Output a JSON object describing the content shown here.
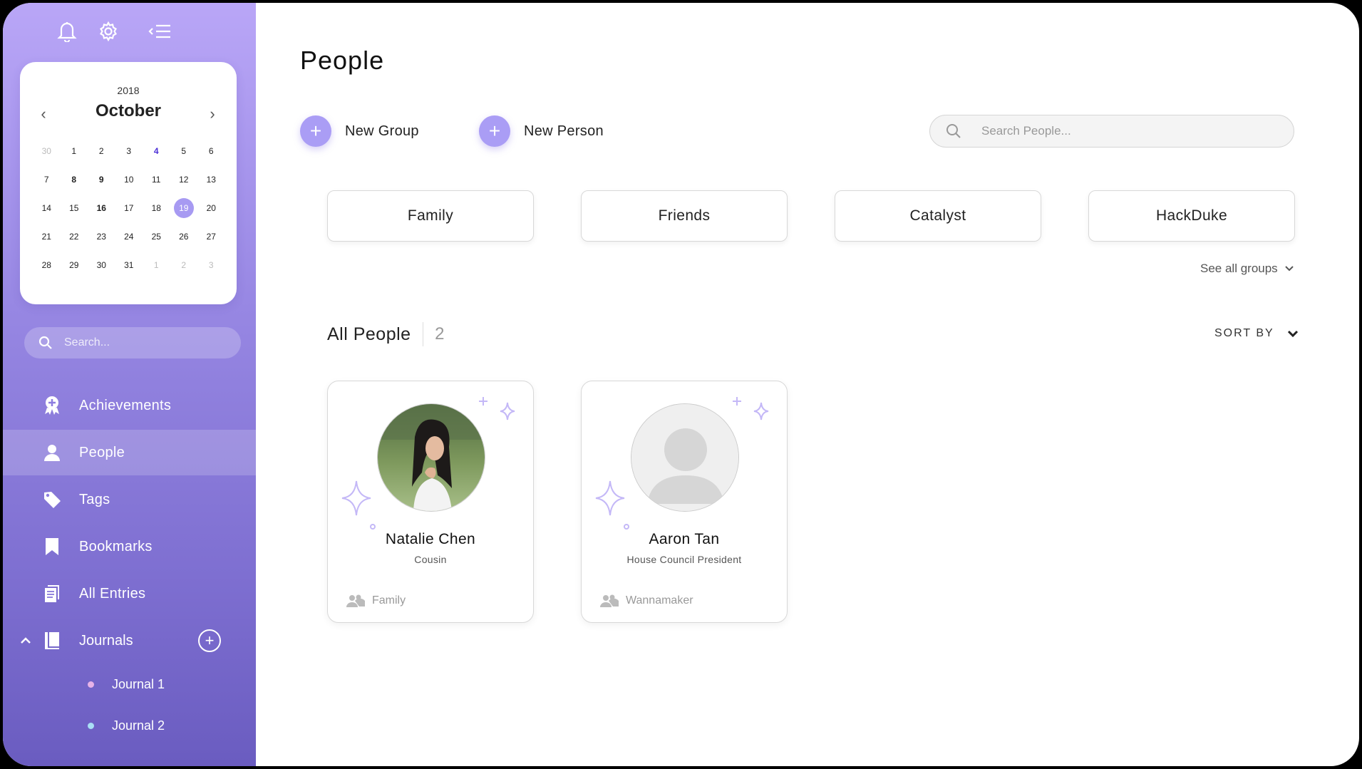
{
  "sidebar": {
    "top_icons": [
      "bell-icon",
      "gear-icon",
      "collapse-menu-icon"
    ],
    "calendar": {
      "year": "2018",
      "month": "October",
      "prev": "‹",
      "next": "›",
      "weeks": [
        [
          {
            "d": "30",
            "s": "muted"
          },
          {
            "d": "1"
          },
          {
            "d": "2"
          },
          {
            "d": "3"
          },
          {
            "d": "4",
            "s": "event"
          },
          {
            "d": "5"
          },
          {
            "d": "6"
          }
        ],
        [
          {
            "d": "7"
          },
          {
            "d": "8",
            "s": "bold"
          },
          {
            "d": "9",
            "s": "bold"
          },
          {
            "d": "10"
          },
          {
            "d": "11"
          },
          {
            "d": "12"
          },
          {
            "d": "13"
          }
        ],
        [
          {
            "d": "14"
          },
          {
            "d": "15"
          },
          {
            "d": "16",
            "s": "bold"
          },
          {
            "d": "17"
          },
          {
            "d": "18"
          },
          {
            "d": "19",
            "s": "selected"
          },
          {
            "d": "20"
          }
        ],
        [
          {
            "d": "21"
          },
          {
            "d": "22"
          },
          {
            "d": "23"
          },
          {
            "d": "24"
          },
          {
            "d": "25"
          },
          {
            "d": "26"
          },
          {
            "d": "27"
          }
        ],
        [
          {
            "d": "28"
          },
          {
            "d": "29"
          },
          {
            "d": "30"
          },
          {
            "d": "31"
          },
          {
            "d": "1",
            "s": "muted"
          },
          {
            "d": "2",
            "s": "muted"
          },
          {
            "d": "3",
            "s": "muted"
          }
        ]
      ]
    },
    "search_placeholder": "Search...",
    "nav": [
      {
        "label": "Achievements",
        "icon": "award-icon",
        "active": false
      },
      {
        "label": "People",
        "icon": "person-icon",
        "active": true
      },
      {
        "label": "Tags",
        "icon": "tag-icon",
        "active": false
      },
      {
        "label": "Bookmarks",
        "icon": "bookmark-icon",
        "active": false
      },
      {
        "label": "All Entries",
        "icon": "entries-icon",
        "active": false
      }
    ],
    "journals": {
      "label": "Journals",
      "add": "+",
      "items": [
        {
          "label": "Journal 1",
          "color": "#e7b3e8"
        },
        {
          "label": "Journal 2",
          "color": "#a9dff5"
        }
      ]
    }
  },
  "main": {
    "title": "People",
    "new_group": "New Group",
    "new_person": "New Person",
    "plus": "+",
    "search_placeholder": "Search People...",
    "groups": [
      "Family",
      "Friends",
      "Catalyst",
      "HackDuke"
    ],
    "see_all_groups": "See all groups",
    "all_people_label": "All People",
    "all_people_count": "2",
    "sort_by": "SORT BY",
    "people": [
      {
        "name": "Natalie Chen",
        "role": "Cousin",
        "group": "Family",
        "avatar": "photo"
      },
      {
        "name": "Aaron Tan",
        "role": "House Council President",
        "group": "Wannamaker",
        "avatar": "placeholder"
      }
    ]
  },
  "colors": {
    "accent": "#aa9df5",
    "sidebar_top": "#b9a6f7",
    "sidebar_bottom": "#6a5cc0",
    "event_day": "#4b2fd6"
  }
}
